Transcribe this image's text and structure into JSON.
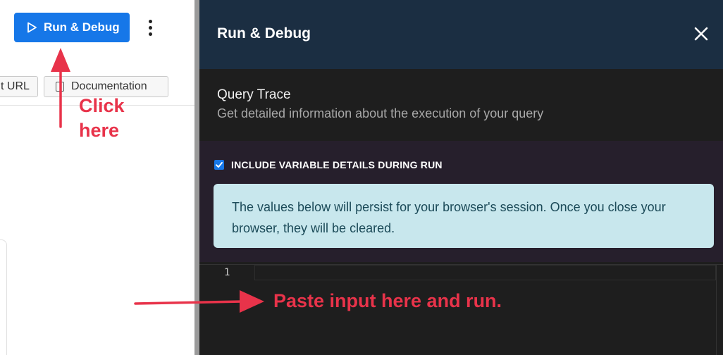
{
  "toolbar": {
    "run_debug_label": "Run & Debug",
    "url_label": "t URL",
    "documentation_label": "Documentation"
  },
  "annotations": {
    "click_line1": "Click",
    "click_line2": "here",
    "paste_text": "Paste input here and run.",
    "color": "#e8334a"
  },
  "panel": {
    "title": "Run & Debug",
    "query_trace": {
      "title": "Query Trace",
      "subtitle": "Get detailed information about the execution of your query"
    },
    "include_variables": {
      "label": "INCLUDE VARIABLE DETAILS DURING RUN",
      "checked": true
    },
    "info_message": "The values below will persist for your browser's session. Once you close your browser, they will be cleared.",
    "editor": {
      "line_numbers": [
        "1"
      ],
      "content": ""
    }
  },
  "colors": {
    "primary": "#1677e8",
    "panel_header_bg": "#1b2e42",
    "panel_bg": "#1e1e1e",
    "vars_section_bg": "#261f2c",
    "info_bg": "#c8e7ed",
    "info_text": "#1b4a58"
  },
  "icons": {
    "run": "play-icon",
    "more": "kebab-menu-icon",
    "close": "close-icon",
    "documentation": "document-icon"
  }
}
